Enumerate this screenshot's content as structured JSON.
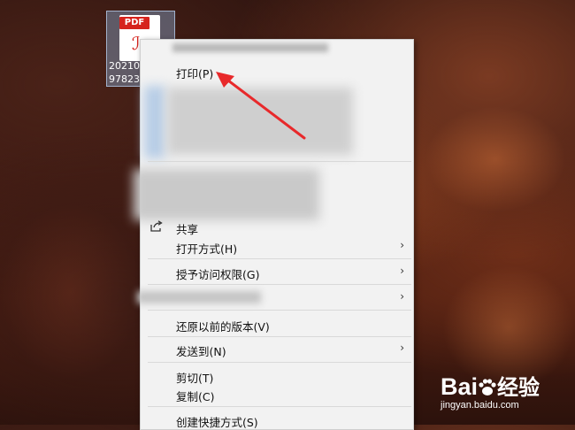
{
  "desktop": {
    "file_icon": {
      "badge": "PDF",
      "name_line1": "20210",
      "name_line2": "97823"
    }
  },
  "context_menu": {
    "print": "打印(P)",
    "share": "共享",
    "open_with": "打开方式(H)",
    "grant_access": "授予访问权限(G)",
    "restore_versions": "还原以前的版本(V)",
    "send_to": "发送到(N)",
    "cut": "剪切(T)",
    "copy": "复制(C)",
    "create_shortcut": "创建快捷方式(S)",
    "submenu_glyph": "›"
  },
  "watermark": {
    "logo_left": "Bai",
    "logo_right": "经验",
    "url": "jingyan.baidu.com"
  },
  "colors": {
    "arrow": "#e8292b",
    "pdf_badge": "#d6231d",
    "menu_bg": "#f2f2f2"
  }
}
